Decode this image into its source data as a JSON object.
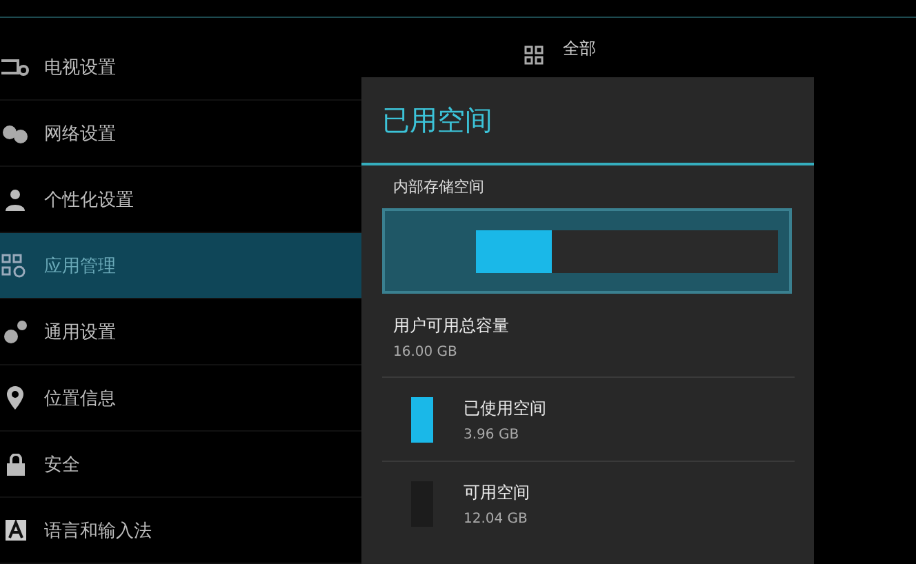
{
  "sidebar": {
    "items": [
      {
        "label": "电视设置",
        "selected": false
      },
      {
        "label": "网络设置",
        "selected": false
      },
      {
        "label": "个性化设置",
        "selected": false
      },
      {
        "label": "应用管理",
        "selected": true
      },
      {
        "label": "通用设置",
        "selected": false
      },
      {
        "label": "位置信息",
        "selected": false
      },
      {
        "label": "安全",
        "selected": false
      },
      {
        "label": "语言和输入法",
        "selected": false
      }
    ]
  },
  "filter": {
    "label": "全部"
  },
  "dialog": {
    "title": "已用空间",
    "section": "内部存储空间",
    "storage_bar": {
      "level": 0.25
    },
    "total": {
      "label": "用户可用总容量",
      "value": "16.00 GB"
    },
    "legend": [
      {
        "label": "已使用空间",
        "value": "3.96 GB",
        "color": "#1ab8e8"
      },
      {
        "label": "可用空间",
        "value": "12.04 GB",
        "color": "#1c1c1c"
      }
    ]
  }
}
